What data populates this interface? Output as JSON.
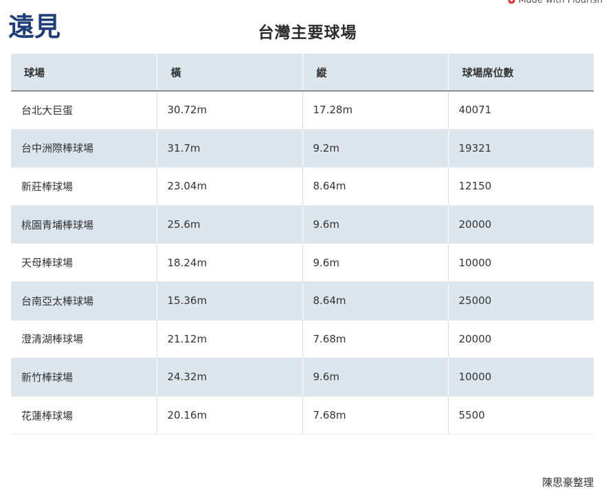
{
  "header": {
    "made_with": "Made with Flourish",
    "title": "台灣主要球場",
    "logo_text": "遠見"
  },
  "table": {
    "columns": [
      "球場",
      "橫",
      "縱",
      "球場席位數"
    ],
    "rows": [
      [
        "台北大巨蛋",
        "30.72m",
        "17.28m",
        "40071"
      ],
      [
        "台中洲際棒球場",
        "31.7m",
        "9.2m",
        "19321"
      ],
      [
        "新莊棒球場",
        "23.04m",
        "8.64m",
        "12150"
      ],
      [
        "桃園青埔棒球場",
        "25.6m",
        "9.6m",
        "20000"
      ],
      [
        "天母棒球場",
        "18.24m",
        "9.6m",
        "10000"
      ],
      [
        "台南亞太棒球場",
        "15.36m",
        "8.64m",
        "25000"
      ],
      [
        "澄清湖棒球場",
        "21.12m",
        "7.68m",
        "20000"
      ],
      [
        "新竹棒球場",
        "24.32m",
        "9.6m",
        "10000"
      ],
      [
        "花蓮棒球場",
        "20.16m",
        "7.68m",
        "5500"
      ]
    ]
  },
  "footer": {
    "source": "陳思豪整理"
  },
  "colors": {
    "header_bg": "#dde6ec",
    "stripe_bg": "#dde6ec",
    "logo_blue": "#1f3e78",
    "flourish_red": "#e8303a"
  }
}
